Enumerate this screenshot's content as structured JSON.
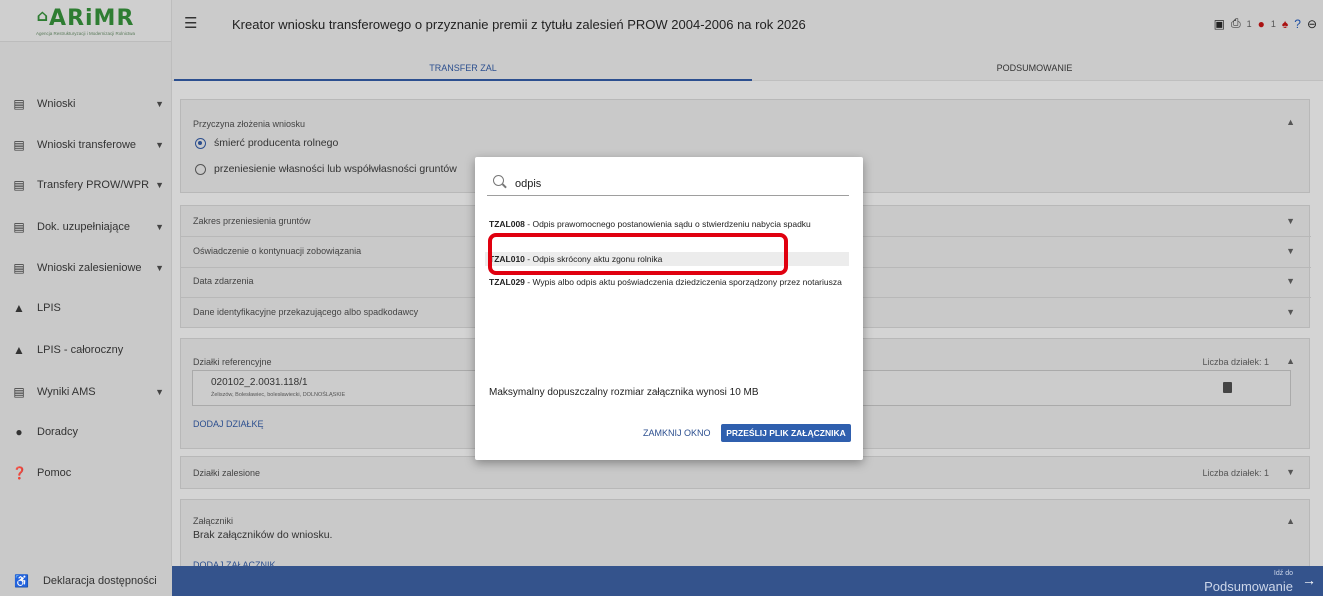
{
  "logo": {
    "text": "ARiMR",
    "subtitle": "Agencja Restrukturyzacji i Modernizacji Rolnictwa"
  },
  "sidebar": {
    "items": [
      {
        "label": "Wnioski",
        "icon": "clipboard-icon",
        "chevron": true
      },
      {
        "label": "Wnioski transferowe",
        "icon": "clipboard-icon",
        "chevron": true
      },
      {
        "label": "Transfery PROW/WPR",
        "icon": "clipboard-icon",
        "chevron": true
      },
      {
        "label": "Dok. uzupełniające",
        "icon": "clipboard-icon",
        "chevron": true
      },
      {
        "label": "Wnioski zalesieniowe",
        "icon": "clipboard-icon",
        "chevron": true
      },
      {
        "label": "LPIS",
        "icon": "landscape-icon",
        "chevron": false
      },
      {
        "label": "LPIS - całoroczny",
        "icon": "landscape-icon",
        "chevron": false
      },
      {
        "label": "Wyniki AMS",
        "icon": "clipboard-icon",
        "chevron": true
      },
      {
        "label": "Doradcy",
        "icon": "person-icon",
        "chevron": false
      },
      {
        "label": "Pomoc",
        "icon": "help-icon",
        "chevron": false
      }
    ],
    "bottom": {
      "label": "Deklaracja dostępności",
      "icon": "accessibility-icon"
    }
  },
  "header": {
    "title": "Kreator wniosku transferowego o przyznanie premii z tytułu zalesień PROW 2004-2006 na rok 2026",
    "errors_count": "1",
    "warnings_count": "1"
  },
  "tabs": [
    {
      "label": "TRANSFER ZAL",
      "active": true
    },
    {
      "label": "PODSUMOWANIE",
      "active": false
    }
  ],
  "main": {
    "reason_label": "Przyczyna złożenia wniosku",
    "reason_options": [
      {
        "label": "śmierć producenta rolnego",
        "selected": true
      },
      {
        "label": "przeniesienie własności lub współwłasności gruntów",
        "selected": false
      }
    ],
    "rows": [
      "Zakres przeniesienia gruntów",
      "Oświadczenie o kontynuacji zobowiązania",
      "Data zdarzenia",
      "Dane identyfikacyjne przekazującego albo spadkodawcy"
    ],
    "plots_label": "Działki referencyjne",
    "plots_count": "Liczba działek: 1",
    "plot_id": "020102_2.0031.118/1",
    "plot_location": "Żeliszów, Bolesławiec, bolesławiecki, DOLNOŚLĄSKIE",
    "add_plot": "DODAJ DZIAŁKĘ",
    "forested_label": "Działki zalesione",
    "forested_count": "Liczba działek: 1",
    "attachments_label": "Załączniki",
    "attachments_empty": "Brak załączników do wniosku.",
    "add_attachment": "DODAJ ZAŁĄCZNIK"
  },
  "footer": {
    "small": "Idź do",
    "big": "Podsumowanie"
  },
  "modal": {
    "search_value": "odpis",
    "options": [
      {
        "code": "TZAL008",
        "text": " - Odpis prawomocnego postanowienia sądu o stwierdzeniu nabycia spadku"
      },
      {
        "code": "TZAL010",
        "text": " - Odpis skrócony aktu zgonu rolnika"
      },
      {
        "code": "TZAL029",
        "text": " - Wypis albo odpis aktu poświadczenia dziedziczenia sporządzony przez notariusza"
      }
    ],
    "info": "Maksymalny dopuszczalny rozmiar załącznika wynosi 10 MB",
    "close_label": "ZAMKNIJ OKNO",
    "send_label": "PRZEŚLIJ PLIK ZAŁĄCZNIKA"
  },
  "colors": {
    "accent": "#2c4f8f",
    "footer": "#34538c",
    "highlight": "#e0000f"
  }
}
